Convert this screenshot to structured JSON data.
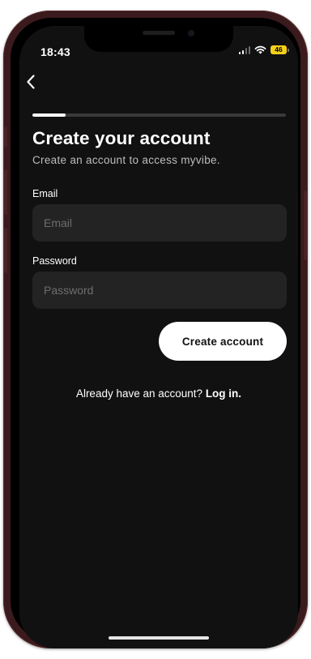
{
  "status_bar": {
    "time": "18:43",
    "battery": "46"
  },
  "onboarding": {
    "progress": 0.13,
    "title": "Create your account",
    "subtitle": "Create an account to access myvibe."
  },
  "form": {
    "email_label": "Email",
    "email_placeholder": "Email",
    "email_value": "",
    "password_label": "Password",
    "password_placeholder": "Password",
    "password_value": "",
    "submit_label": "Create account"
  },
  "footer": {
    "prompt": "Already have an account?",
    "login_label": "Log in."
  },
  "icons": {
    "back": "chevron-left-icon",
    "signal": "cellular-signal-icon",
    "wifi": "wifi-icon",
    "battery": "battery-icon"
  },
  "colors": {
    "background": "#111111",
    "input_background": "#232323",
    "button_background": "#ffffff",
    "progress_fill": "#ffffff",
    "progress_track": "#3a3a3a",
    "battery_fill": "#f5d01b",
    "frame": "#3a1a1d"
  }
}
